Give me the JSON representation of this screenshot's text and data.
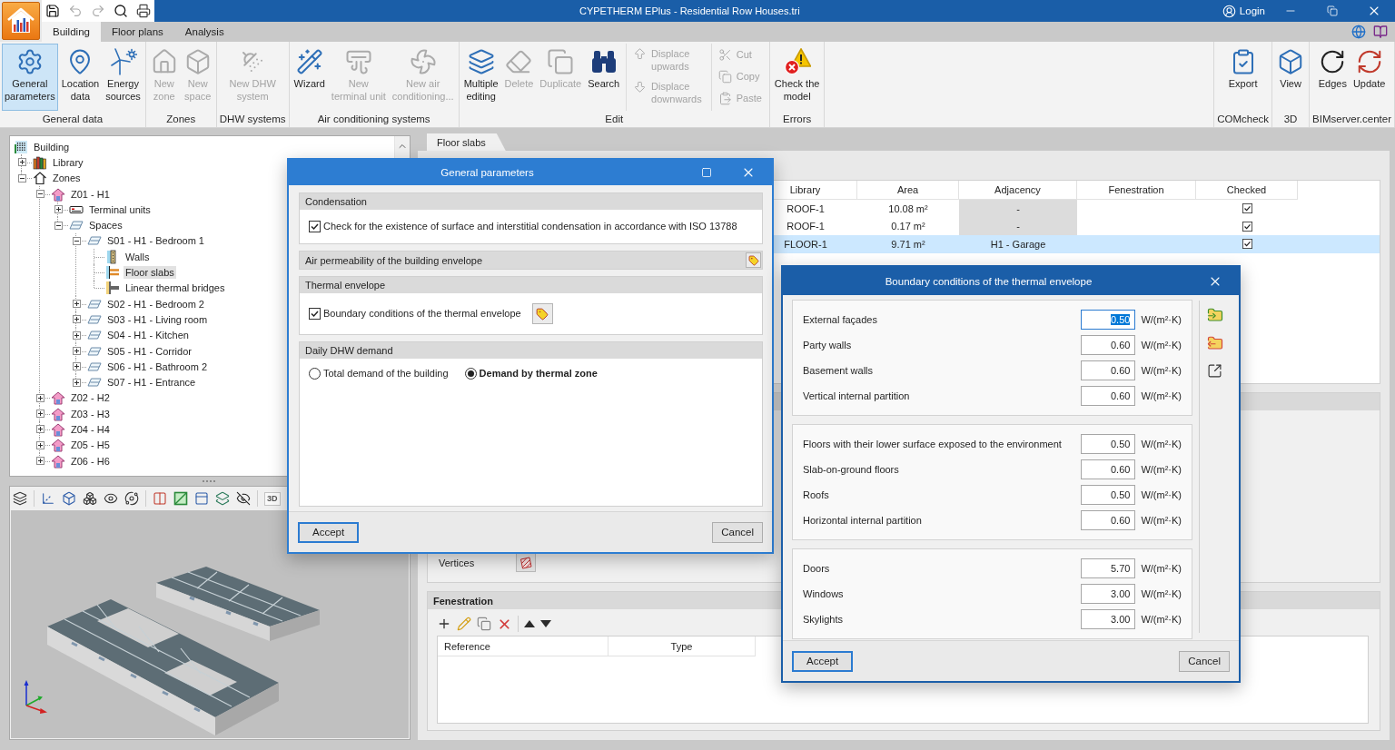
{
  "window": {
    "title": "CYPETHERM EPlus - Residential Row Houses.tri",
    "login": "Login"
  },
  "ribbon_tabs": [
    {
      "label": "Building",
      "selected": true
    },
    {
      "label": "Floor plans",
      "selected": false
    },
    {
      "label": "Analysis",
      "selected": false
    }
  ],
  "ribbon": {
    "groups": [
      {
        "label": "General data",
        "items": [
          {
            "kind": "large",
            "label": "General\nparameters",
            "selected": true,
            "disabled": false
          },
          {
            "kind": "large",
            "label": "Location\ndata",
            "selected": false,
            "disabled": false
          },
          {
            "kind": "large",
            "label": "Energy\nsources",
            "selected": false,
            "disabled": false
          }
        ]
      },
      {
        "label": "Zones",
        "items": [
          {
            "kind": "large",
            "label": "New\nzone",
            "selected": false,
            "disabled": true
          },
          {
            "kind": "large",
            "label": "New\nspace",
            "selected": false,
            "disabled": true
          }
        ]
      },
      {
        "label": "DHW systems",
        "items": [
          {
            "kind": "large",
            "label": "New DHW\nsystem",
            "selected": false,
            "disabled": true
          }
        ]
      },
      {
        "label": "Air conditioning systems",
        "items": [
          {
            "kind": "large",
            "label": "Wizard",
            "selected": false,
            "disabled": false
          },
          {
            "kind": "large",
            "label": "New\nterminal unit",
            "selected": false,
            "disabled": true
          },
          {
            "kind": "large",
            "label": "New air\nconditioning...",
            "selected": false,
            "disabled": true
          }
        ]
      },
      {
        "label": "Edit",
        "items": [
          {
            "kind": "large",
            "label": "Multiple\nediting",
            "selected": false,
            "disabled": false
          },
          {
            "kind": "large",
            "label": "Delete",
            "selected": false,
            "disabled": true
          },
          {
            "kind": "large",
            "label": "Duplicate",
            "selected": false,
            "disabled": true
          },
          {
            "kind": "large",
            "label": "Search",
            "selected": false,
            "disabled": false
          },
          {
            "kind": "stack",
            "buttons": [
              {
                "label": "Displace\nupwards",
                "disabled": true
              },
              {
                "label": "Displace\ndownwards",
                "disabled": true
              }
            ]
          },
          {
            "kind": "stack",
            "buttons": [
              {
                "label": "Cut",
                "disabled": true
              },
              {
                "label": "Copy",
                "disabled": true
              },
              {
                "label": "Paste",
                "disabled": true
              }
            ]
          }
        ]
      },
      {
        "label": "Errors",
        "items": [
          {
            "kind": "large",
            "label": "Check the\nmodel",
            "selected": false,
            "disabled": false
          }
        ]
      }
    ],
    "right_groups": [
      {
        "label": "COMcheck",
        "items": [
          {
            "kind": "large",
            "label": "Export",
            "selected": false,
            "disabled": false
          }
        ]
      },
      {
        "label": "3D",
        "items": [
          {
            "kind": "large",
            "label": "View",
            "selected": false,
            "disabled": false
          }
        ]
      },
      {
        "label": "BIMserver.center",
        "items": [
          {
            "kind": "large",
            "label": "Edges",
            "selected": false,
            "disabled": false
          },
          {
            "kind": "large",
            "label": "Update",
            "selected": false,
            "disabled": false
          }
        ]
      }
    ]
  },
  "tree": {
    "label": "Building",
    "kind": "building",
    "selected": false,
    "children": [
      {
        "label": "Library",
        "kind": "library",
        "expanded": false,
        "selected": false
      },
      {
        "label": "Zones",
        "kind": "zones",
        "expanded": true,
        "selected": false,
        "children": [
          {
            "label": "Z01 - H1",
            "kind": "zone",
            "expanded": true,
            "selected": false,
            "children": [
              {
                "label": "Terminal units",
                "kind": "terminal_units",
                "expanded": false,
                "selected": false
              },
              {
                "label": "Spaces",
                "kind": "spaces",
                "expanded": true,
                "selected": false,
                "children": [
                  {
                    "label": "S01 - H1 - Bedroom 1",
                    "kind": "space",
                    "expanded": true,
                    "selected": false,
                    "children": [
                      {
                        "label": "Walls",
                        "kind": "walls",
                        "selected": false
                      },
                      {
                        "label": "Floor slabs",
                        "kind": "floor_slabs",
                        "selected": true
                      },
                      {
                        "label": "Linear thermal bridges",
                        "kind": "thermal_bridges",
                        "selected": false
                      }
                    ]
                  },
                  {
                    "label": "S02 - H1 - Bedroom 2",
                    "kind": "space",
                    "expanded": false,
                    "selected": false
                  },
                  {
                    "label": "S03 - H1 - Living room",
                    "kind": "space",
                    "expanded": false,
                    "selected": false
                  },
                  {
                    "label": "S04 - H1 - Kitchen",
                    "kind": "space",
                    "expanded": false,
                    "selected": false
                  },
                  {
                    "label": "S05 - H1 - Corridor",
                    "kind": "space",
                    "expanded": false,
                    "selected": false
                  },
                  {
                    "label": "S06 - H1 - Bathroom 2",
                    "kind": "space",
                    "expanded": false,
                    "selected": false
                  },
                  {
                    "label": "S07 - H1 - Entrance",
                    "kind": "space",
                    "expanded": false,
                    "selected": false
                  }
                ]
              }
            ]
          },
          {
            "label": "Z02 - H2",
            "kind": "zone",
            "expanded": false,
            "selected": false
          },
          {
            "label": "Z03 - H3",
            "kind": "zone",
            "expanded": false,
            "selected": false
          },
          {
            "label": "Z04 - H4",
            "kind": "zone",
            "expanded": false,
            "selected": false
          },
          {
            "label": "Z05 - H5",
            "kind": "zone",
            "expanded": false,
            "selected": false
          },
          {
            "label": "Z06 - H6",
            "kind": "zone",
            "expanded": false,
            "selected": false
          }
        ]
      }
    ]
  },
  "viewer": {
    "view_3d_label": "3D"
  },
  "panel": {
    "tabs": [
      {
        "label": "Floor slabs",
        "selected": true
      }
    ],
    "slabs": {
      "columns": [
        "Library",
        "Area",
        "Adjacency",
        "Fenestration",
        "Checked"
      ],
      "rows": [
        {
          "library": "ROOF-1",
          "area": "10.08 m²",
          "adjacency": "-",
          "adjacency_disabled": true,
          "checked": true,
          "selected": false
        },
        {
          "library": "ROOF-1",
          "area": "0.17 m²",
          "adjacency": "-",
          "adjacency_disabled": true,
          "checked": true,
          "selected": false
        },
        {
          "library": "FLOOR-1",
          "area": "9.71 m²",
          "adjacency": "H1 - Garage",
          "adjacency_disabled": false,
          "checked": true,
          "selected": true
        }
      ]
    },
    "vertices_label": "Vertices",
    "fenestration": {
      "title": "Fenestration",
      "columns": [
        "Reference",
        "Type"
      ]
    }
  },
  "general_dialog": {
    "title": "General parameters",
    "sections": [
      {
        "kind": "checkbox",
        "title": "Condensation",
        "option": {
          "label": "Check for the existence of surface and interstitial condensation in accordance with ISO 13788",
          "checked": true
        }
      },
      {
        "kind": "header_button",
        "title": "Air permeability of the building envelope"
      },
      {
        "kind": "checkbox",
        "title": "Thermal envelope",
        "option": {
          "label": "Boundary conditions of the thermal envelope",
          "checked": true,
          "has_button": true
        }
      },
      {
        "kind": "radio",
        "title": "Daily DHW demand",
        "options": [
          {
            "label": "Total demand of the building",
            "selected": false
          },
          {
            "label": "Demand by thermal zone",
            "selected": true
          }
        ]
      }
    ],
    "buttons": [
      {
        "label": "Accept",
        "default": true
      },
      {
        "label": "Cancel",
        "default": false
      }
    ]
  },
  "boundary_dialog": {
    "title": "Boundary conditions of the thermal envelope",
    "groups": [
      {
        "rows": [
          {
            "label": "External façades",
            "value": "0.50",
            "unit": "W/(m²·K)",
            "focused": true
          },
          {
            "label": "Party walls",
            "value": "0.60",
            "unit": "W/(m²·K)",
            "focused": false
          },
          {
            "label": "Basement walls",
            "value": "0.60",
            "unit": "W/(m²·K)",
            "focused": false
          },
          {
            "label": "Vertical internal partition",
            "value": "0.60",
            "unit": "W/(m²·K)",
            "focused": false
          }
        ]
      },
      {
        "rows": [
          {
            "label": "Floors with their lower surface exposed to the environment",
            "value": "0.50",
            "unit": "W/(m²·K)",
            "focused": false
          },
          {
            "label": "Slab-on-ground floors",
            "value": "0.60",
            "unit": "W/(m²·K)",
            "focused": false
          },
          {
            "label": "Roofs",
            "value": "0.50",
            "unit": "W/(m²·K)",
            "focused": false
          },
          {
            "label": "Horizontal internal partition",
            "value": "0.60",
            "unit": "W/(m²·K)",
            "focused": false
          }
        ]
      },
      {
        "rows": [
          {
            "label": "Doors",
            "value": "5.70",
            "unit": "W/(m²·K)",
            "focused": false
          },
          {
            "label": "Windows",
            "value": "3.00",
            "unit": "W/(m²·K)",
            "focused": false
          },
          {
            "label": "Skylights",
            "value": "3.00",
            "unit": "W/(m²·K)",
            "focused": false
          }
        ]
      }
    ],
    "buttons": [
      {
        "label": "Accept",
        "default": true
      },
      {
        "label": "Cancel",
        "default": false
      }
    ]
  }
}
